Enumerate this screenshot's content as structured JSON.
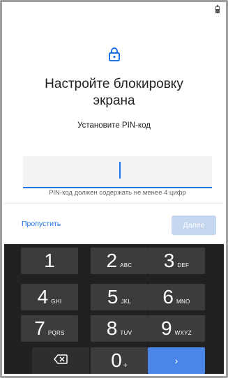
{
  "screen": {
    "title": "Настройте блокировку экрана",
    "subtitle": "Установите PIN-код",
    "pin_value": "",
    "hint": "PIN-код должен содержать не менее 4 цифр"
  },
  "actions": {
    "skip_label": "Пропустить",
    "next_label": "Далее"
  },
  "keypad": {
    "k1": {
      "num": "1",
      "sub": ""
    },
    "k2": {
      "num": "2",
      "sub": "ABC"
    },
    "k3": {
      "num": "3",
      "sub": "DEF"
    },
    "k4": {
      "num": "4",
      "sub": "GHI"
    },
    "k5": {
      "num": "5",
      "sub": "JKL"
    },
    "k6": {
      "num": "6",
      "sub": "MNO"
    },
    "k7": {
      "num": "7",
      "sub": "PQRS"
    },
    "k8": {
      "num": "8",
      "sub": "TUV"
    },
    "k9": {
      "num": "9",
      "sub": "WXYZ"
    },
    "k0": {
      "num": "0",
      "sub": "+"
    },
    "enter_symbol": "›"
  },
  "icons": {
    "lock": "lock-icon",
    "backspace": "backspace-icon",
    "battery": "battery-icon"
  },
  "colors": {
    "accent": "#1a73e8",
    "keyboard_bg": "#212121",
    "key_bg": "#3c3c3c",
    "enter_key": "#4a86e8",
    "next_disabled": "#c5d6ef"
  }
}
